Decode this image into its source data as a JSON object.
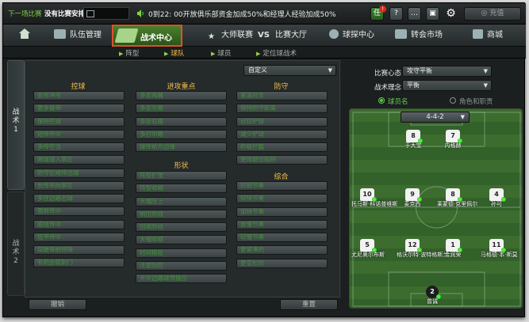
{
  "topbar": {
    "next_match_label": "下一场比赛",
    "no_match_label": "没有比赛安排",
    "ticker": "0到22: 00开放俱乐部资金加成50%和经理人经验加成50%",
    "calendar_icon": "calendar-icon",
    "recharge_label": "充值"
  },
  "nav": {
    "items": [
      "队伍管理",
      "战术中心",
      "大师联赛",
      "比赛大厅",
      "球探中心",
      "转会市场",
      "商城"
    ],
    "vs_label": "VS"
  },
  "subnav": {
    "items": [
      "阵型",
      "球队",
      "球员",
      "定位球战术"
    ]
  },
  "left_tabs": [
    "战术1",
    "战术2"
  ],
  "tactic_preset": "自定义",
  "sections": {
    "pass": {
      "title": "控球",
      "items": [
        "长传冲吊",
        "更多盘带",
        "保持控球",
        "短传传中",
        "多传空当",
        "两球插入禁区",
        "防守区域传出球",
        "长传吊向禁区",
        "多往边路出球",
        "面前传中",
        "底线传中",
        "低平传中",
        "突破等前特殊",
        "有机会就射门"
      ]
    },
    "attack": {
      "title": "进攻重点",
      "items": [
        "多走两翼",
        "多走左路",
        "多走右路",
        "多打中路",
        "球传前方边锋"
      ]
    },
    "formation": {
      "title": "形状",
      "items": [
        "阵型扩张",
        "阵型收缩",
        "大幅压上",
        "前压防线",
        "回收防线",
        "大幅收缩",
        "时间拖延",
        "注意防控",
        "允许边路球员插位"
      ]
    },
    "defense": {
      "title": "防守",
      "items": [
        "紧逼对手",
        "保持防守距离",
        "比较铲球",
        "减少铲球",
        "积极拦截",
        "使用越位陷阱"
      ]
    },
    "overall": {
      "title": "综合",
      "items": [
        "控制节奏",
        "较快节奏",
        "加快节奏",
        "放慢节奏",
        "较慢节奏",
        "更紧凑的",
        "更宽松的"
      ]
    }
  },
  "bottom_buttons": {
    "undo": "撤销",
    "reset": "重置"
  },
  "right_panel": {
    "mentality_label": "比赛心态",
    "mentality_value": "攻守平衡",
    "philosophy_label": "战术理念",
    "philosophy_value": "平衡",
    "radio_name": "球员名",
    "radio_role": "角色和职责",
    "formation_value": "4-4-2"
  },
  "players": [
    {
      "number": "8",
      "name": "于大宝"
    },
    {
      "number": "7",
      "name": "内格赫"
    },
    {
      "number": "10",
      "name": "托马斯·科诺普维斯"
    },
    {
      "number": "9",
      "name": "麦克西"
    },
    {
      "number": "8",
      "name": "莱蒙德·克里佩尔"
    },
    {
      "number": "4",
      "name": "孙可"
    },
    {
      "number": "5",
      "name": "尤尼奥尔布斯"
    },
    {
      "number": "12",
      "name": "格沃尔特·波特格斯兰"
    },
    {
      "number": "1",
      "name": "金润荣"
    },
    {
      "number": "11",
      "name": "马格德·本·斯莫"
    },
    {
      "number": "2",
      "name": "曾诚"
    }
  ]
}
